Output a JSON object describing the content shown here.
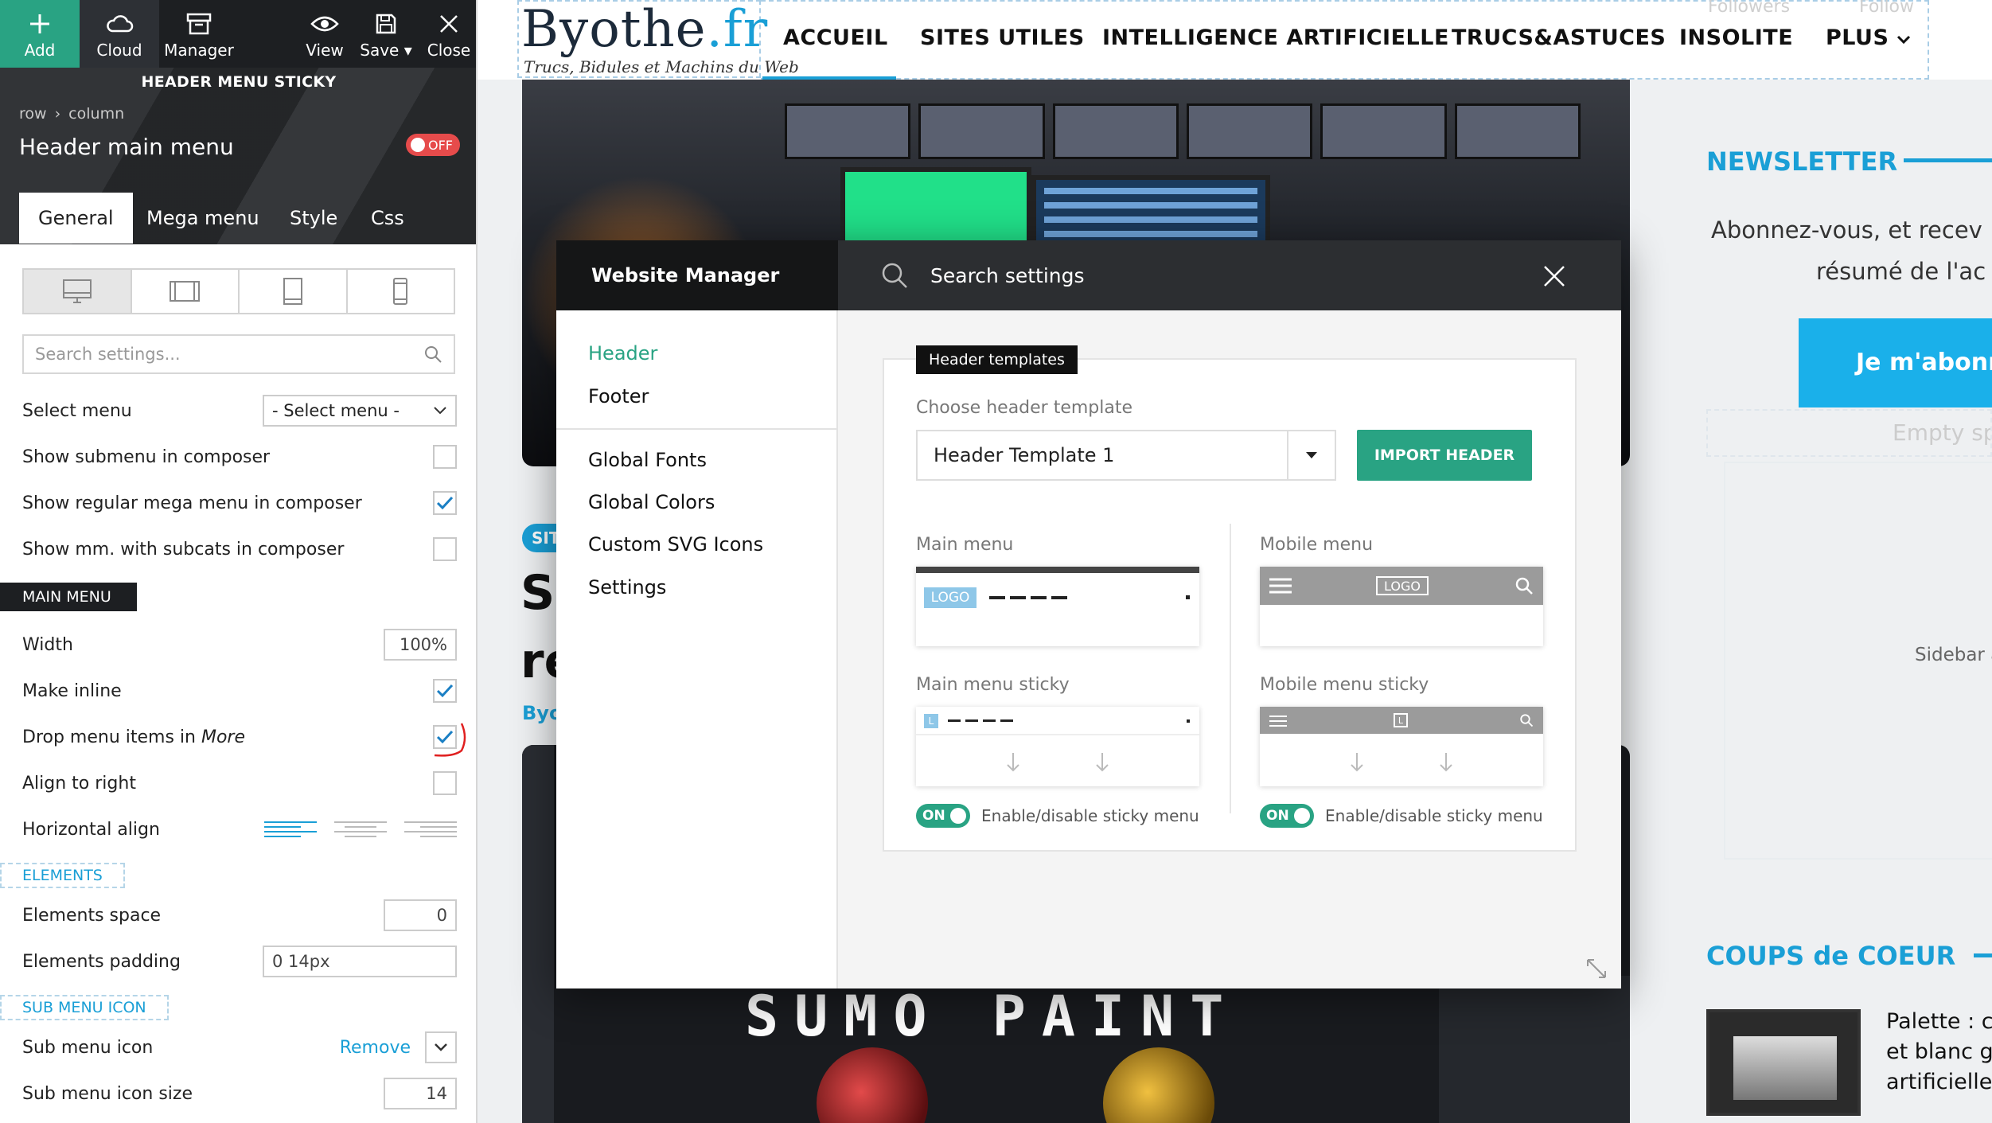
{
  "toolbar": {
    "add_label": "Add",
    "cloud_label": "Cloud",
    "manager_label": "Manager",
    "view_label": "View",
    "save_label": "Save",
    "close_label": "Close"
  },
  "panel": {
    "subtitle": "HEADER MENU STICKY",
    "breadcrumb": [
      "row",
      "column"
    ],
    "title": "Header main menu",
    "toggle": "OFF",
    "tabs": [
      "General",
      "Mega menu",
      "Style",
      "Css"
    ],
    "search_placeholder": "Search settings...",
    "select_menu_label": "Select menu",
    "select_menu_value": "- Select menu -",
    "show_submenu_label": "Show submenu in composer",
    "show_regular_mega_label": "Show regular mega menu in composer",
    "show_mm_subcats_label": "Show mm. with subcats in composer",
    "main_menu_section": "MAIN MENU",
    "width_label": "Width",
    "width_value": "100%",
    "make_inline_label": "Make inline",
    "drop_items_label": "Drop menu items in ",
    "drop_items_em": "More",
    "align_right_label": "Align to right",
    "horizontal_align_label": "Horizontal align",
    "elements_section": "ELEMENTS",
    "elements_space_label": "Elements space",
    "elements_space_value": "0",
    "elements_padding_label": "Elements padding",
    "elements_padding_value": "0 14px",
    "sub_menu_icon_section": "SUB MENU ICON",
    "sub_menu_icon_label": "Sub menu icon",
    "remove_label": "Remove",
    "sub_menu_icon_size_label": "Sub menu icon size",
    "sub_menu_icon_size_value": "14"
  },
  "site": {
    "logo_main": "Byothe",
    "logo_tld": ".fr",
    "logo_tagline": "Trucs, Bidules et Machins du Web",
    "nav": [
      "ACCUEIL",
      "SITES UTILES",
      "INTELLIGENCE ARTIFICIELLE",
      "TRUCS&ASTUCES",
      "INSOLITE",
      "PLUS"
    ],
    "faint_followers": "Followers",
    "faint_follow": "Follow",
    "category_badge": "SIT",
    "title_frag_1": "Su",
    "title_frag_2": "re",
    "author_frag": "Byo",
    "image_title": "SUMO PAINT",
    "newsletter_title": "NEWSLETTER",
    "newsletter_text_1": "Abonnez-vous, et recev",
    "newsletter_text_2": "résumé de l'ac",
    "subscribe_label": "Je m'abonn",
    "empty_space": "Empty sp",
    "sidebar_label": "Sidebar a",
    "coups_title": "COUPS de COEUR",
    "palette_line_1": "Palette : co",
    "palette_line_2": "et blanc gra",
    "palette_line_3": "artificielle"
  },
  "modal": {
    "title": "Website Manager",
    "search_text": "Search settings",
    "nav": [
      "Header",
      "Footer",
      "Global Fonts",
      "Global Colors",
      "Custom SVG Icons",
      "Settings"
    ],
    "badge": "Header templates",
    "choose_label": "Choose header template",
    "template_value": "Header Template 1",
    "import_label": "IMPORT HEADER",
    "main_menu_label": "Main menu",
    "mobile_menu_label": "Mobile menu",
    "main_sticky_label": "Main menu sticky",
    "mobile_sticky_label": "Mobile menu sticky",
    "logo_chip": "LOGO",
    "logo_chip_small": "L",
    "on_label": "ON",
    "sticky_toggle_label": "Enable/disable sticky menu"
  },
  "colors": {
    "accent_green": "#29a383",
    "accent_blue": "#1a9fd6",
    "toggle_red": "#e64b4b",
    "dark": "#1d1f22"
  }
}
